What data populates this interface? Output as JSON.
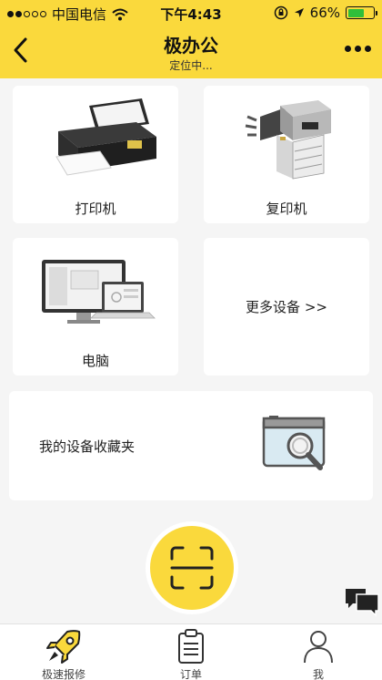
{
  "status_bar": {
    "carrier": "中国电信",
    "time": "下午4:43",
    "battery": "66%",
    "battery_level": 0.66,
    "battery_color": "#2fbf3a"
  },
  "header": {
    "title": "极办公",
    "subtitle": "定位中...",
    "back_icon": "chevron-left-icon",
    "more_icon": "more-dots-icon"
  },
  "devices": {
    "printer_label": "打印机",
    "copier_label": "复印机",
    "computer_label": "电脑",
    "more_label": "更多设备 >>"
  },
  "favorites": {
    "label": "我的设备收藏夹"
  },
  "tabbar": {
    "items": [
      {
        "label": "极速报修",
        "icon": "rocket-icon"
      },
      {
        "label": "订单",
        "icon": "clipboard-icon"
      },
      {
        "label": "我",
        "icon": "person-icon"
      }
    ]
  },
  "colors": {
    "accent": "#fad93c",
    "background": "#f5f5f5"
  }
}
